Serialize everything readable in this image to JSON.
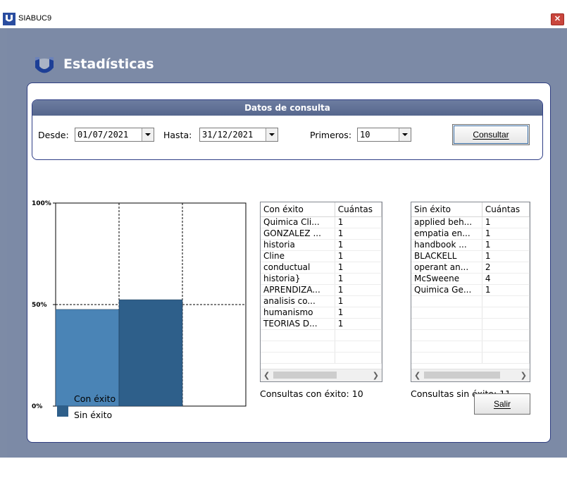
{
  "window": {
    "title": "SIABUC9",
    "close_label": "✕"
  },
  "header": {
    "title": "Estadísticas"
  },
  "query": {
    "title": "Datos de consulta",
    "desde_label": "Desde:",
    "desde_value": "01/07/2021",
    "hasta_label": "Hasta:",
    "hasta_value": "31/12/2021",
    "primeros_label": "Primeros:",
    "primeros_value": "10",
    "consultar_label": "Consultar"
  },
  "chart_data": {
    "type": "bar",
    "categories": [
      "Con éxito",
      "Sin éxito"
    ],
    "values": [
      47.6,
      52.4
    ],
    "ylim": [
      0,
      100
    ],
    "ytick_labels": [
      "100%",
      "50%",
      "0%"
    ],
    "colors": [
      "#4a84b6",
      "#2e5f8a"
    ],
    "legend": [
      "Con éxito",
      "Sin éxito"
    ],
    "legend_position": "bottom-left",
    "grid": "dashed"
  },
  "success_table": {
    "headers": [
      "Con éxito",
      "Cuántas"
    ],
    "rows": [
      [
        "Quimica Cli...",
        "1"
      ],
      [
        "GONZALEZ ...",
        "1"
      ],
      [
        "historia",
        "1"
      ],
      [
        "Cline",
        "1"
      ],
      [
        "conductual",
        "1"
      ],
      [
        "historia}",
        "1"
      ],
      [
        "APRENDIZA...",
        "1"
      ],
      [
        "analisis co...",
        "1"
      ],
      [
        "humanismo",
        "1"
      ],
      [
        "TEORIAS D...",
        "1"
      ]
    ],
    "footer": "Consultas con éxito: 10"
  },
  "fail_table": {
    "headers": [
      "Sin éxito",
      "Cuántas"
    ],
    "rows": [
      [
        "applied beh...",
        "1"
      ],
      [
        "empatia en...",
        "1"
      ],
      [
        "handbook ...",
        "1"
      ],
      [
        "BLACKELL",
        "1"
      ],
      [
        "operant an...",
        "2"
      ],
      [
        "McSweene",
        "4"
      ],
      [
        "Quimica Ge...",
        "1"
      ]
    ],
    "footer": "Consultas sin éxito: 11"
  },
  "salir_label": "Salir"
}
